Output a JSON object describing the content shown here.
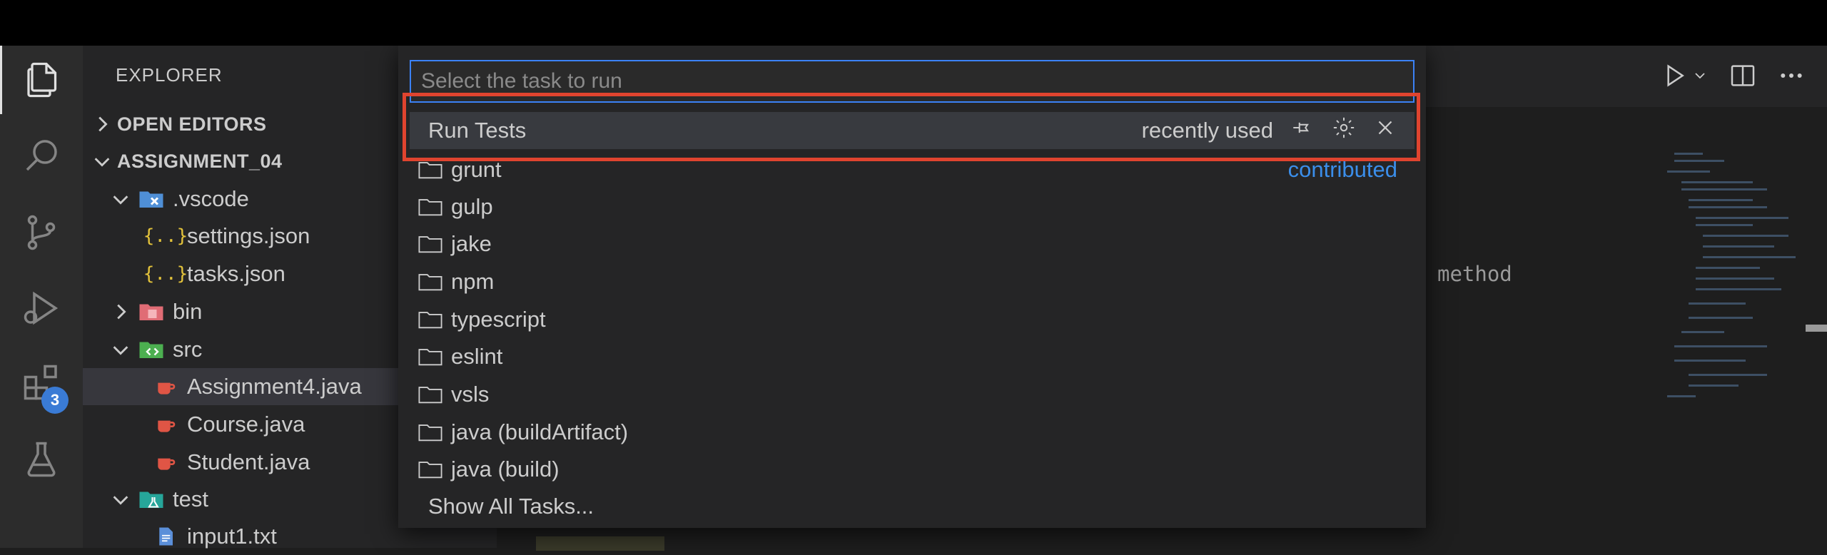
{
  "explorer": {
    "title": "EXPLORER",
    "sections": {
      "open_editors": "OPEN EDITORS",
      "project": "ASSIGNMENT_04"
    },
    "tree": {
      "vscode_folder": ".vscode",
      "settings": "settings.json",
      "tasks": "tasks.json",
      "bin": "bin",
      "src": "src",
      "assignment4": "Assignment4.java",
      "course": "Course.java",
      "student": "Student.java",
      "test": "test",
      "input1": "input1.txt"
    }
  },
  "activity_bar": {
    "extensions_badge": "3"
  },
  "quick_pick": {
    "placeholder": "Select the task to run",
    "selected": {
      "label": "Run Tests",
      "description": "recently used"
    },
    "contributed_label": "contributed",
    "items": [
      "grunt",
      "gulp",
      "jake",
      "npm",
      "typescript",
      "eslint",
      "vsls",
      "java (buildArtifact)",
      "java (build)"
    ],
    "show_all": "Show All Tasks..."
  },
  "editor": {
    "code_fragment": "method"
  },
  "colors": {
    "accent": "#3b82f6",
    "highlight": "#e0442f",
    "badge": "#3a7bd5"
  }
}
